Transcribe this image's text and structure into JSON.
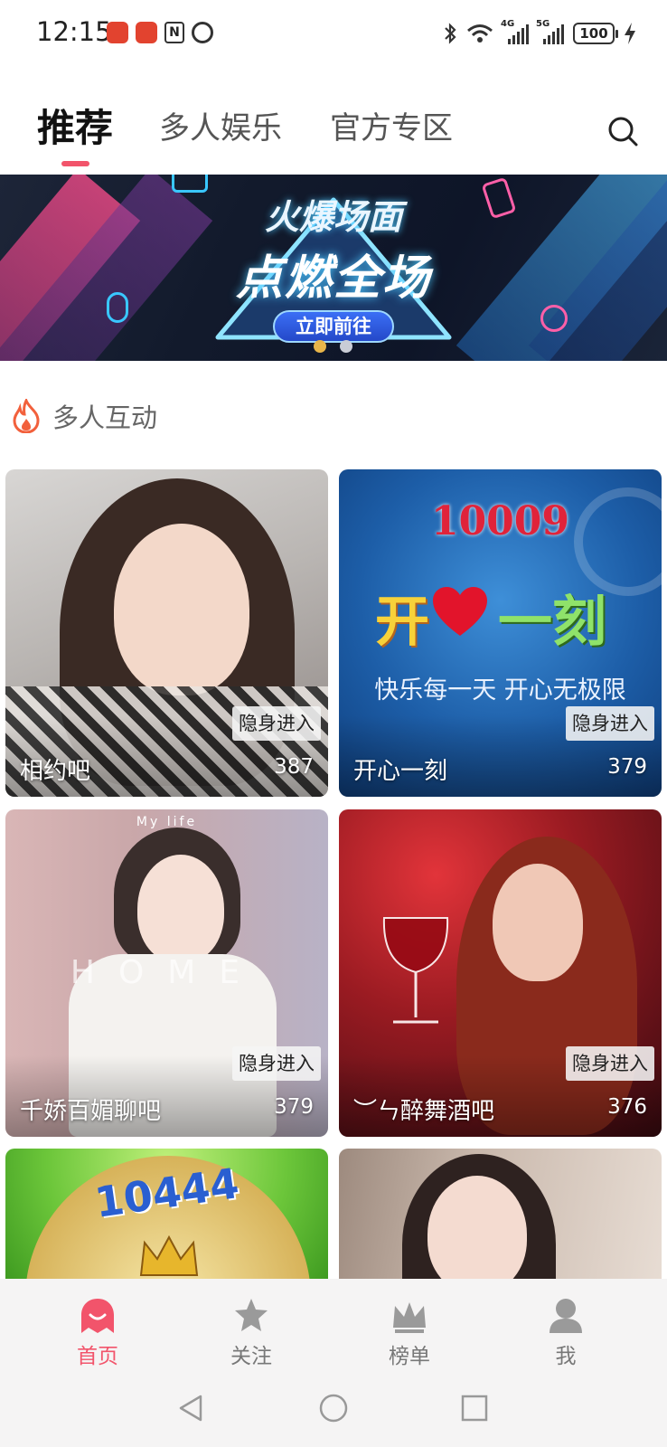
{
  "status_bar": {
    "time": "12:15",
    "network_1": "4G",
    "network_2": "5G",
    "battery": "100"
  },
  "top_tabs": [
    {
      "label": "推荐",
      "active": true
    },
    {
      "label": "多人娱乐",
      "active": false
    },
    {
      "label": "官方专区",
      "active": false
    }
  ],
  "banner": {
    "title_line1": "火爆场面",
    "title_line2": "点燃全场",
    "cta": "立即前往",
    "page_count": 2,
    "active_page": 1
  },
  "section": {
    "title": "多人互动",
    "icon": "fire-icon"
  },
  "rooms": [
    {
      "name": "相约吧",
      "count": "387",
      "tag": "隐身进入"
    },
    {
      "name": "开心一刻",
      "count": "379",
      "tag": "隐身进入",
      "poster_number": "10009",
      "poster_title_a": "开",
      "poster_title_b": "一刻",
      "poster_slogan": "快乐每一天 开心无极限"
    },
    {
      "name": "千娇百媚聊吧",
      "count": "379",
      "tag": "隐身进入",
      "poster_watermark": "HOME",
      "poster_top": "My life"
    },
    {
      "name": "︶ㄣ醉舞酒吧",
      "count": "376",
      "tag": "隐身进入"
    },
    {
      "name": "",
      "count": "",
      "tag": "",
      "poster_number": "10444"
    },
    {
      "name": "",
      "count": "",
      "tag": ""
    }
  ],
  "bottom_nav": [
    {
      "label": "首页",
      "icon": "home-ghost-icon",
      "active": true
    },
    {
      "label": "关注",
      "icon": "star-icon",
      "active": false
    },
    {
      "label": "榜单",
      "icon": "crown-icon",
      "active": false
    },
    {
      "label": "我",
      "icon": "person-icon",
      "active": false
    }
  ],
  "colors": {
    "accent": "#f2546b",
    "banner_dot_active": "#e8b54a"
  }
}
